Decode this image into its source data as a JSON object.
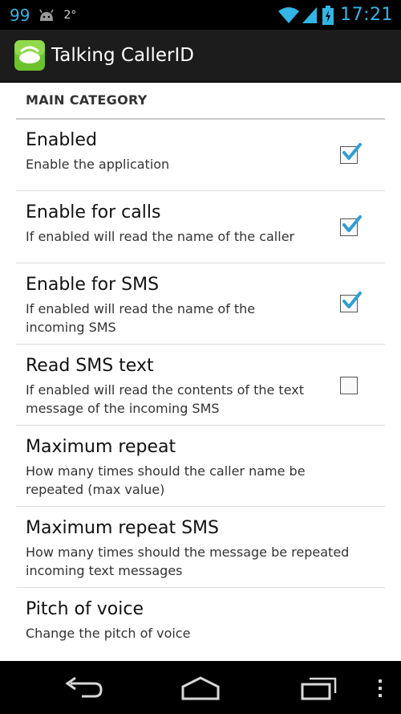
{
  "statusbar": {
    "notification_count": "99",
    "temperature": "2°",
    "time": "17:21"
  },
  "actionbar": {
    "app_title": "Talking CallerID"
  },
  "category": {
    "label": "MAIN CATEGORY"
  },
  "preferences": [
    {
      "title": "Enabled",
      "summary": "Enable the application",
      "checkbox": true,
      "checked": true
    },
    {
      "title": "Enable for calls",
      "summary": "If enabled will read the name of the caller",
      "checkbox": true,
      "checked": true
    },
    {
      "title": "Enable for SMS",
      "summary": "If enabled will read the name of the incoming SMS",
      "checkbox": true,
      "checked": true
    },
    {
      "title": "Read SMS text",
      "summary": "If enabled will read the contents of the text message of the incoming SMS",
      "checkbox": true,
      "checked": false
    },
    {
      "title": "Maximum repeat",
      "summary": "How many times should the caller name be repeated (max value)",
      "checkbox": false
    },
    {
      "title": "Maximum repeat SMS",
      "summary": "How many times should the message be repeated incoming text messages",
      "checkbox": false
    },
    {
      "title": "Pitch of voice",
      "summary": "Change the pitch of voice",
      "checkbox": false
    }
  ],
  "icons": {
    "status": [
      "android-icon",
      "wifi-icon",
      "signal-icon",
      "battery-icon"
    ],
    "navigation": [
      "back-icon",
      "home-icon",
      "recent-apps-icon",
      "overflow-menu-icon"
    ]
  },
  "colors": {
    "accent": "#33b5e5",
    "checkmark": "#2e9fd6",
    "actionbar": "#1c1c1c"
  }
}
